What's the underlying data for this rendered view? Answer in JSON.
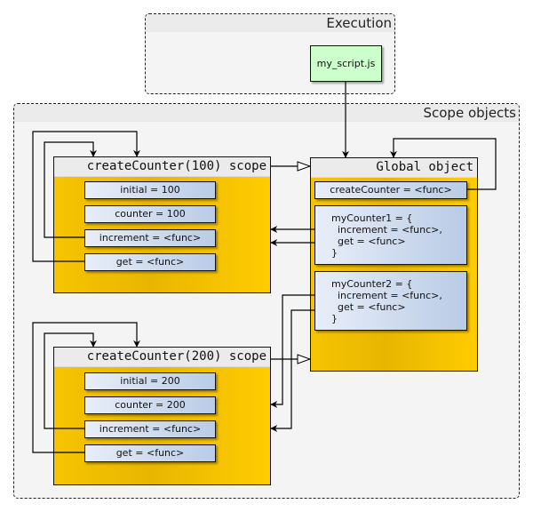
{
  "frames": {
    "execution": "Execution",
    "scope_objects": "Scope objects"
  },
  "script": "my_script.js",
  "scopes": {
    "counter100": {
      "title": "createCounter(100) scope",
      "vars": [
        "initial = 100",
        "counter = 100",
        "increment = <func>",
        "get = <func>"
      ]
    },
    "counter200": {
      "title": "createCounter(200) scope",
      "vars": [
        "initial = 200",
        "counter = 200",
        "increment = <func>",
        "get = <func>"
      ]
    },
    "global": {
      "title": "Global object",
      "vars": [
        "createCounter = <func>",
        "myCounter1 = {\n  increment = <func>,\n  get = <func>\n}",
        "myCounter2 = {\n  increment = <func>,\n  get = <func>\n}"
      ]
    }
  }
}
